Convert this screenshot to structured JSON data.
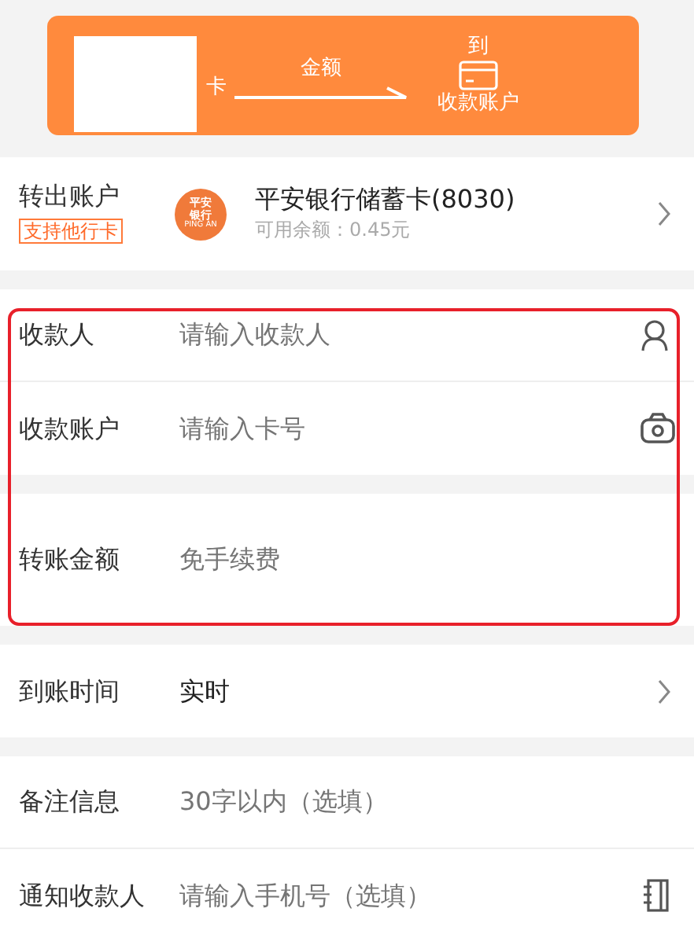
{
  "banner": {
    "source_label": "卡",
    "amount_label": "金额",
    "to_label": "到",
    "destination_label": "收款账户"
  },
  "from_account": {
    "label": "转出账户",
    "tag": "支持他行卡",
    "logo_lines": [
      "平安",
      "银行"
    ],
    "logo_caption": "PING AN",
    "account_name": "平安银行储蓄卡(8030)",
    "balance": "可用余额：0.45元"
  },
  "sections": [
    {
      "highlighted": true,
      "rows": [
        {
          "kind": "person",
          "label": "收款人",
          "placeholder": "请输入收款人"
        },
        {
          "kind": "camera",
          "label": "收款账户",
          "placeholder": "请输入卡号"
        }
      ]
    },
    {
      "highlighted": true,
      "rows": [
        {
          "kind": "plain",
          "label": "转账金额",
          "placeholder": "免手续费",
          "tall": true
        }
      ]
    },
    {
      "highlighted": false,
      "rows": [
        {
          "kind": "select",
          "label": "到账时间",
          "value": "实时"
        }
      ]
    },
    {
      "highlighted": false,
      "rows": [
        {
          "kind": "plain",
          "label": "备注信息",
          "placeholder": "30字以内（选填）"
        },
        {
          "kind": "book",
          "label": "通知收款人",
          "placeholder": "请输入手机号（选填）"
        }
      ]
    }
  ]
}
